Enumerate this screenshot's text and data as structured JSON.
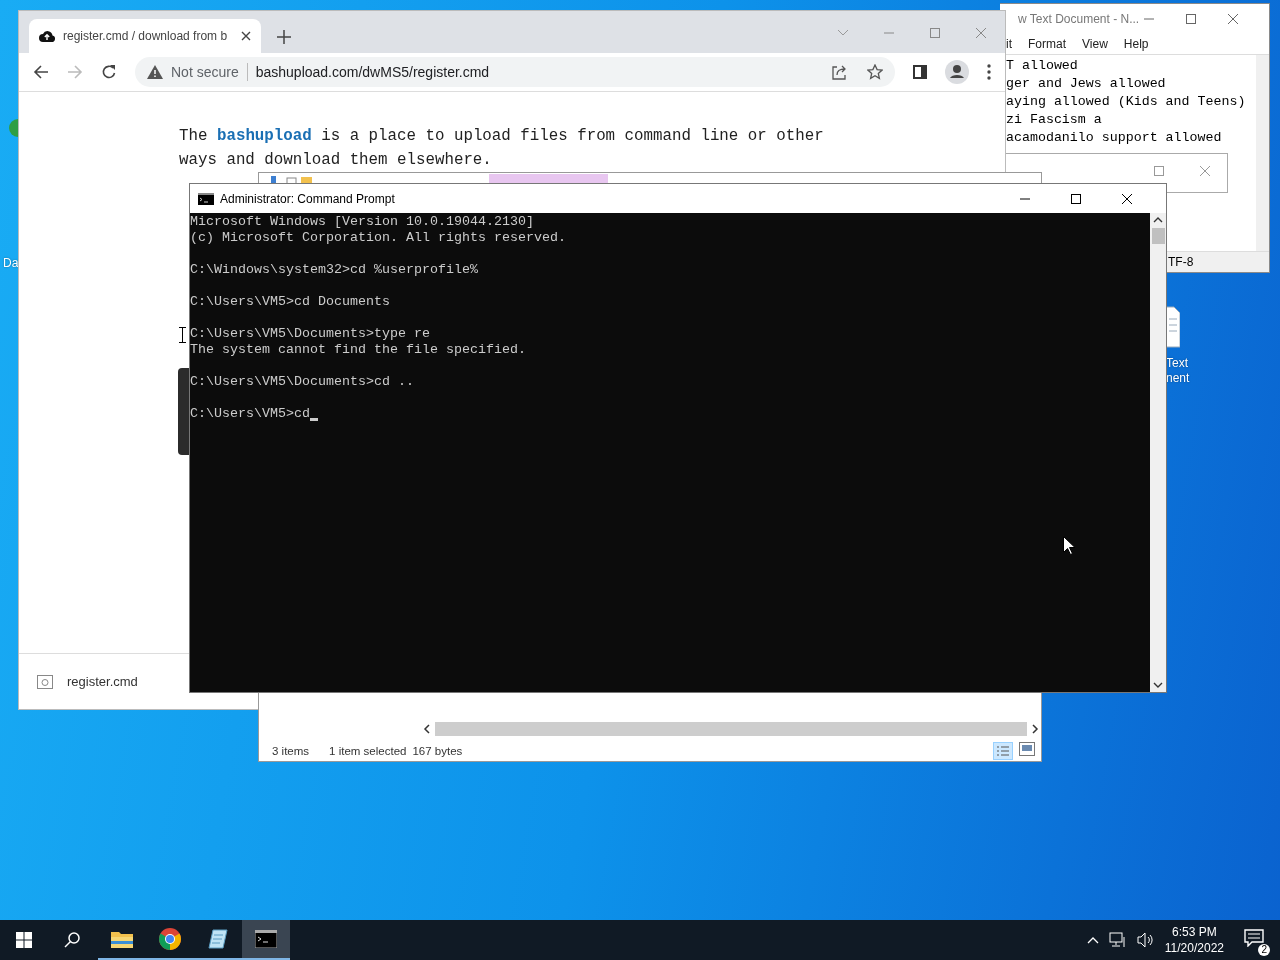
{
  "notepad": {
    "title": "w Text Document - N...",
    "menus": [
      "it",
      "Format",
      "View",
      "Help"
    ],
    "lines": [
      "T allowed",
      "ger and Jews allowed",
      "aying allowed (Kids and Teens)",
      "zi Fascism a",
      "acamodanilo support allowed"
    ],
    "status": "TF-8"
  },
  "browser": {
    "tab_title": "register.cmd / download from b",
    "warning": "Not secure",
    "url": "bashupload.com/dwMS5/register.cmd",
    "intro_before": "The",
    "link": "bashupload",
    "intro_after": "is a place to upload files from command line or other ways and download them elsewhere.",
    "download": "register.cmd"
  },
  "explorer": {
    "items_count": "3 items",
    "selection": "1 item selected",
    "size": "167 bytes"
  },
  "cmd": {
    "title": "Administrator: Command Prompt",
    "blocks": [
      [
        "Microsoft Windows [Version 10.0.19044.2130]",
        "(c) Microsoft Corporation. All rights reserved."
      ],
      [
        "C:\\Windows\\system32>cd %userprofile%"
      ],
      [
        "C:\\Users\\VM5>cd Documents"
      ],
      [
        "C:\\Users\\VM5\\Documents>type re",
        "The system cannot find the file specified."
      ],
      [
        "C:\\Users\\VM5\\Documents>cd .."
      ],
      [
        "C:\\Users\\VM5>cd"
      ]
    ]
  },
  "desktop_labels": [
    "Da",
    "Text",
    "nent"
  ],
  "taskbar": {
    "items": [
      {
        "kind": "start",
        "running": false,
        "selected": false
      },
      {
        "kind": "search",
        "running": false,
        "selected": false
      },
      {
        "kind": "explorer",
        "running": true,
        "selected": false
      },
      {
        "kind": "chrome",
        "running": true,
        "selected": false
      },
      {
        "kind": "notepad",
        "running": true,
        "selected": false
      },
      {
        "kind": "terminal",
        "running": true,
        "selected": true
      }
    ],
    "time": "6:53 PM",
    "date": "11/20/2022",
    "notifications": "2"
  }
}
